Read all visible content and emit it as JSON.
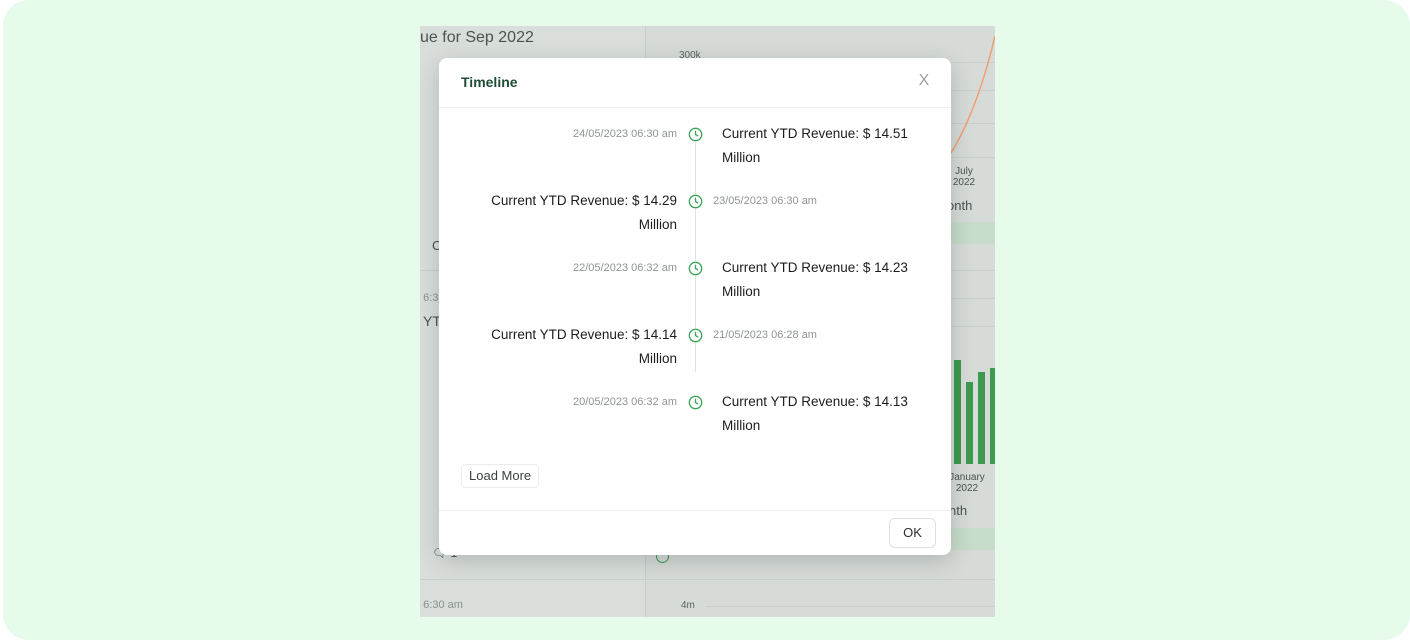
{
  "background": {
    "heading_fragment": "ue for Sep 2022",
    "axis_top_label": "300k",
    "top_xtick_month": "July",
    "top_xtick_year": "2022",
    "top_axis_title_fragment": "onth",
    "left_fragment_c": "C",
    "left_time_fragment_1": "5 6:3",
    "left_title_fragment": "YT",
    "bottom_xtick_month": "January",
    "bottom_xtick_year": "2022",
    "bottom_axis_title_fragment": "nth",
    "left_comment_fragment": "🗨 1",
    "bottom_time_fragment": "5 6:30 am",
    "axis_bottom_label": "4m"
  },
  "modal": {
    "title": "Timeline",
    "close_label": "X",
    "entries": [
      {
        "time": "24/05/2023 06:30 am",
        "text": "Current YTD Revenue: $ 14.51 Million",
        "side": "right"
      },
      {
        "time": "23/05/2023 06:30 am",
        "text": "Current YTD Revenue: $ 14.29 Million",
        "side": "left"
      },
      {
        "time": "22/05/2023 06:32 am",
        "text": "Current YTD Revenue: $ 14.23 Million",
        "side": "right"
      },
      {
        "time": "21/05/2023 06:28 am",
        "text": "Current YTD Revenue: $ 14.14 Million",
        "side": "left"
      },
      {
        "time": "20/05/2023 06:32 am",
        "text": "Current YTD Revenue: $ 14.13 Million",
        "side": "right"
      }
    ],
    "load_more_label": "Load More",
    "ok_label": "OK"
  },
  "colors": {
    "accent_green": "#3aa55a",
    "title_green": "#1f4d34",
    "outer_background": "#e6fbea"
  },
  "icons": {
    "timeline_marker": "clock-icon",
    "close": "close-icon"
  }
}
